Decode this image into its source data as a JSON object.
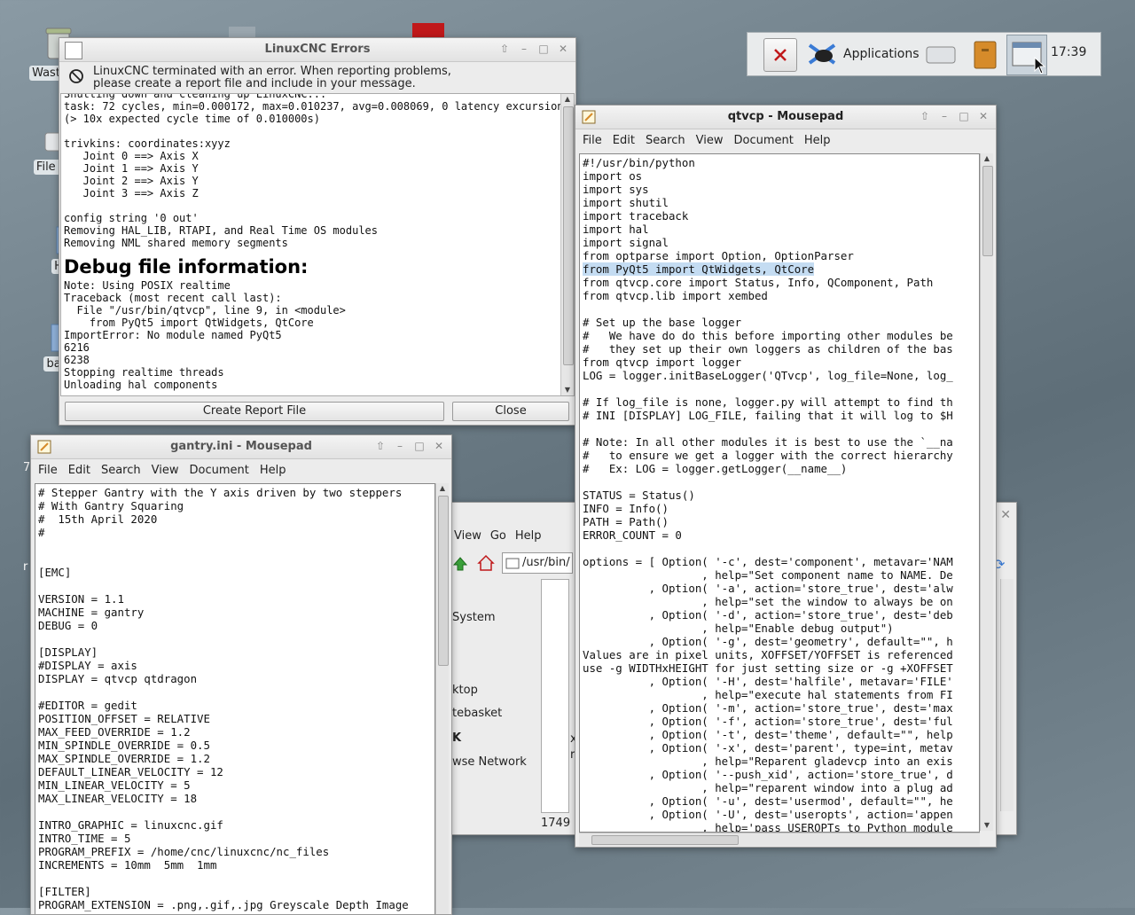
{
  "desktop": {
    "icons": [
      {
        "label": "Waste",
        "name": "trash"
      },
      {
        "label": "File S",
        "name": "filesystem"
      },
      {
        "label": "Ho",
        "name": "home"
      },
      {
        "label": "baz",
        "name": "folder"
      }
    ],
    "edge_labels": [
      "7",
      "r"
    ]
  },
  "panel": {
    "apps_label": "Applications",
    "clock": "17:39"
  },
  "errors_window": {
    "title": "LinuxCNC Errors",
    "message_line1": "LinuxCNC terminated with an error.  When reporting problems,",
    "message_line2": "please create a report file and include in your message.",
    "log_top": "Shutting down and cleaning up LinuxCNC...\ntask: 72 cycles, min=0.000172, max=0.010237, avg=0.008069, 0 latency excursions\n(> 10x expected cycle time of 0.010000s)\n\ntrivkins: coordinates:xyyz\n   Joint 0 ==> Axis X\n   Joint 1 ==> Axis Y\n   Joint 2 ==> Axis Y\n   Joint 3 ==> Axis Z\n\nconfig string '0 out'\nRemoving HAL_LIB, RTAPI, and Real Time OS modules\nRemoving NML shared memory segments",
    "debug_heading": "Debug file information:",
    "log_bottom": "Note: Using POSIX realtime\nTraceback (most recent call last):\n  File \"/usr/bin/qtvcp\", line 9, in <module>\n    from PyQt5 import QtWidgets, QtCore\nImportError: No module named PyQt5\n6216\n6238\nStopping realtime threads\nUnloading hal components",
    "create_report_label": "Create Report File",
    "close_label": "Close"
  },
  "qtvcp_window": {
    "title": "qtvcp - Mousepad",
    "menu": [
      "File",
      "Edit",
      "Search",
      "View",
      "Document",
      "Help"
    ],
    "lines_before": "#!/usr/bin/python\nimport os\nimport sys\nimport shutil\nimport traceback\nimport hal\nimport signal\nfrom optparse import Option, OptionParser",
    "highlighted_line": "from PyQt5 import QtWidgets, QtCore",
    "lines_after": "from qtvcp.core import Status, Info, QComponent, Path\nfrom qtvcp.lib import xembed\n\n# Set up the base logger\n#   We have do do this before importing other modules be\n#   they set up their own loggers as children of the bas\nfrom qtvcp import logger\nLOG = logger.initBaseLogger('QTvcp', log_file=None, log_\n\n# If log_file is none, logger.py will attempt to find th\n# INI [DISPLAY] LOG_FILE, failing that it will log to $H\n\n# Note: In all other modules it is best to use the `__na\n#   to ensure we get a logger with the correct hierarchy\n#   Ex: LOG = logger.getLogger(__name__)\n\nSTATUS = Status()\nINFO = Info()\nPATH = Path()\nERROR_COUNT = 0\n\noptions = [ Option( '-c', dest='component', metavar='NAM\n                  , help=\"Set component name to NAME. De\n          , Option( '-a', action='store_true', dest='alw\n                  , help=\"set the window to always be on\n          , Option( '-d', action='store_true', dest='deb\n                  , help=\"Enable debug output\")\n          , Option( '-g', dest='geometry', default=\"\", h\nValues are in pixel units, XOFFSET/YOFFSET is referenced\nuse -g WIDTHxHEIGHT for just setting size or -g +XOFFSET\n          , Option( '-H', dest='halfile', metavar='FILE'\n                  , help=\"execute hal statements from FI\n          , Option( '-m', action='store_true', dest='max\n          , Option( '-f', action='store_true', dest='ful\n          , Option( '-t', dest='theme', default=\"\", help\n          , Option( '-x', dest='parent', type=int, metav\n                  , help=\"Reparent gladevcp into an exis\n          , Option( '--push_xid', action='store_true', d\n                  , help=\"reparent window into a plug ad\n          , Option( '-u', dest='usermod', default=\"\", he\n          , Option( '-U', dest='useropts', action='appen\n                  , help='pass USEROPTs to Python module"
  },
  "gantry_window": {
    "title": "gantry.ini - Mousepad",
    "menu": [
      "File",
      "Edit",
      "Search",
      "View",
      "Document",
      "Help"
    ],
    "content": "# Stepper Gantry with the Y axis driven by two steppers\n# With Gantry Squaring\n#  15th April 2020\n#\n\n\n[EMC]\n\nVERSION = 1.1\nMACHINE = gantry\nDEBUG = 0\n\n[DISPLAY]\n#DISPLAY = axis\nDISPLAY = qtvcp qtdragon\n\n#EDITOR = gedit\nPOSITION_OFFSET = RELATIVE\nMAX_FEED_OVERRIDE = 1.2\nMIN_SPINDLE_OVERRIDE = 0.5\nMAX_SPINDLE_OVERRIDE = 1.2\nDEFAULT_LINEAR_VELOCITY = 12\nMIN_LINEAR_VELOCITY = 5\nMAX_LINEAR_VELOCITY = 18\n\nINTRO_GRAPHIC = linuxcnc.gif\nINTRO_TIME = 5\nPROGRAM_PREFIX = /home/cnc/linuxcnc/nc_files\nINCREMENTS = 10mm  5mm  1mm\n\n[FILTER]\nPROGRAM_EXTENSION = .png,.gif,.jpg Greyscale Depth Image"
  },
  "file_manager": {
    "menu": [
      "View",
      "Go",
      "Help"
    ],
    "path": "/usr/bin/",
    "side_items": [
      "System",
      "ktop",
      "tebasket",
      "K",
      "wse Network"
    ],
    "status": "1749",
    "mid_chars": [
      "x",
      "r"
    ]
  }
}
